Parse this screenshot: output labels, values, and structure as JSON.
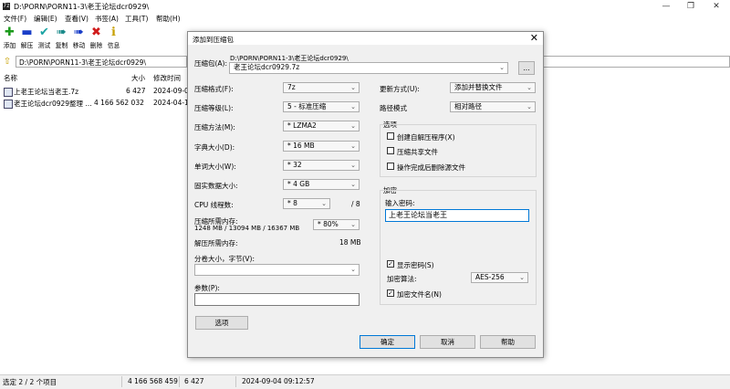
{
  "window": {
    "title": "D:\\PORN\\PORN11-3\\老王论坛dcr0929\\",
    "app_icon_text": "7z"
  },
  "menu": [
    "文件(F)",
    "编辑(E)",
    "查看(V)",
    "书签(A)",
    "工具(T)",
    "帮助(H)"
  ],
  "toolbar": [
    {
      "label": "添加",
      "icon": "plus-icon",
      "color": "#1a9a1a",
      "glyph": "+"
    },
    {
      "label": "解压",
      "icon": "minus-icon",
      "color": "#1a3ec8",
      "glyph": "−"
    },
    {
      "label": "测试",
      "icon": "check-icon",
      "color": "#1aa3a3",
      "glyph": "✔"
    },
    {
      "label": "复制",
      "icon": "copy-arrow-icon",
      "color": "#1a8a8a",
      "glyph": "➜"
    },
    {
      "label": "移动",
      "icon": "move-arrow-icon",
      "color": "#1a3ec8",
      "glyph": "➜"
    },
    {
      "label": "删除",
      "icon": "delete-x-icon",
      "color": "#d01c1c",
      "glyph": "✖"
    },
    {
      "label": "信息",
      "icon": "info-icon",
      "color": "#c8a000",
      "glyph": "i"
    }
  ],
  "address": {
    "path": "D:\\PORN\\PORN11-3\\老王论坛dcr0929\\"
  },
  "file_list": {
    "headers": {
      "name": "名称",
      "size": "大小",
      "modified": "修改时间"
    },
    "rows": [
      {
        "name": "上老王论坛当老王.7z",
        "size": "6 427",
        "modified": "2024-09-0"
      },
      {
        "name": "老王论坛dcr0929整理 ...",
        "size": "4 166 562 032",
        "modified": "2024-04-1"
      }
    ]
  },
  "status": {
    "selected": "选定 2 / 2 个项目",
    "total_size": "4 166 568 459",
    "selected_size": "6 427",
    "datetime": "2024-09-04 09:12:57"
  },
  "dialog": {
    "title": "添加到压缩包",
    "archive_label": "压缩包(A):",
    "archive_dir": "D:\\PORN\\PORN11-3\\老王论坛dcr0929\\",
    "archive_name": "老王论坛dcr0929.7z",
    "browse_label": "...",
    "format_label": "压缩格式(F):",
    "format_value": "7z",
    "level_label": "压缩等级(L):",
    "level_value": "5 - 标准压缩",
    "method_label": "压缩方法(M):",
    "method_value": "* LZMA2",
    "dict_label": "字典大小(D):",
    "dict_value": "* 16 MB",
    "word_label": "单词大小(W):",
    "word_value": "* 32",
    "solid_label": "固实数据大小:",
    "solid_value": "* 4 GB",
    "threads_label": "CPU 线程数:",
    "threads_value": "* 8",
    "threads_total": "/ 8",
    "mem_comp_label": "压缩所需内存:",
    "mem_comp_detail": "1248 MB / 13094 MB / 16367 MB",
    "mem_comp_value": "* 80%",
    "mem_decomp_label": "解压所需内存:",
    "mem_decomp_value": "18 MB",
    "split_label": "分卷大小，字节(V):",
    "split_value": "",
    "params_label": "参数(P):",
    "params_value": "",
    "options_button": "选项",
    "update_label": "更新方式(U):",
    "update_value": "添加并替换文件",
    "pathmode_label": "路径模式",
    "pathmode_value": "相对路径",
    "options_group": "选项",
    "opt_sfx": "创建自解压程序(X)",
    "opt_shared": "压缩共享文件",
    "opt_delete": "操作完成后删除源文件",
    "encrypt_group": "加密",
    "password_label": "输入密码:",
    "password_value": "上老王论坛当老王",
    "show_password": "显示密码(S)",
    "enc_method_label": "加密算法:",
    "enc_method_value": "AES-256",
    "encrypt_names": "加密文件名(N)",
    "ok": "确定",
    "cancel": "取消",
    "help": "帮助"
  }
}
